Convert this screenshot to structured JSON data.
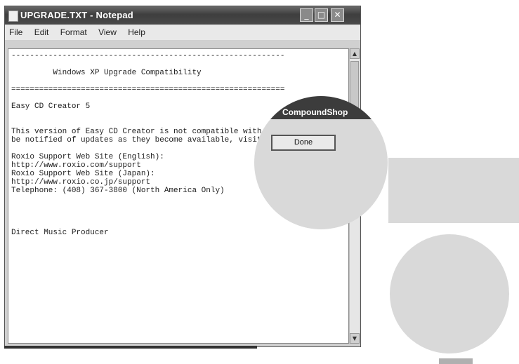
{
  "window": {
    "title": "UPGRADE.TXT - Notepad",
    "buttons": {
      "minimize": "_",
      "maximize": "□",
      "close": "✕"
    }
  },
  "menu": [
    "File",
    "Edit",
    "Format",
    "View",
    "Help"
  ],
  "document_text": "-----------------------------------------------------------\n\n         Windows XP Upgrade Compatibility\n\n===========================================================\n\nEasy CD Creator 5\n\n\nThis version of Easy CD Creator is not compatible with Windows XP. To\nbe notified of updates as they become available, visit the Roxio Web site.\n\nRoxio Support Web Site (English):\nhttp://www.roxio.com/support\nRoxio Support Web Site (Japan):\nhttp://www.roxio.co.jp/support\nTelephone: (408) 367-3800 (North America Only)\n\n\n\n\nDirect Music Producer",
  "magnifier": {
    "window_title": "CompoundShop",
    "button_label": "Done"
  },
  "scrollbar": {
    "up": "▲",
    "down": "▼"
  }
}
